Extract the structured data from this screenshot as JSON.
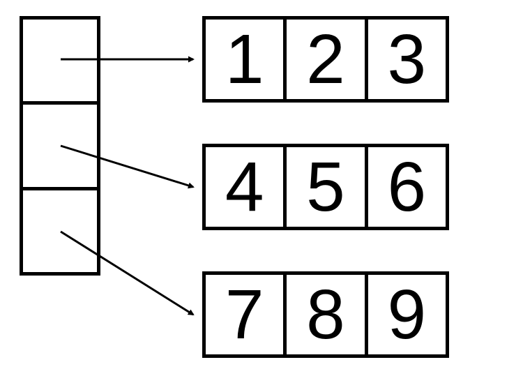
{
  "diagram": {
    "left_column_cells": [
      null,
      null,
      null
    ],
    "rows": [
      {
        "cells": [
          "1",
          "2",
          "3"
        ]
      },
      {
        "cells": [
          "4",
          "5",
          "6"
        ]
      },
      {
        "cells": [
          "7",
          "8",
          "9"
        ]
      }
    ]
  }
}
